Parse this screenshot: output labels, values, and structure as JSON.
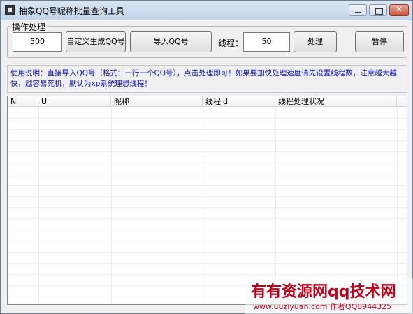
{
  "window": {
    "title": "抽象QQ号昵称批量查询工具",
    "controls": {
      "minimize": "minimize-icon",
      "maximize": "maximize-icon",
      "close": "✕"
    }
  },
  "ops_group": {
    "label": "操作处理",
    "count_value": "500",
    "gen_button": "自定义生成QQ号",
    "import_button": "导入QQ号",
    "threads_label": "线程：",
    "threads_value": "50",
    "process_button": "处理",
    "pause_button": "暂停"
  },
  "instructions": "使用说明：直接导入QQ号（格式：一行一个QQ号），点击处理即可！如果要加快处理速度请先设置线程数，注意越大越快，越容易死机，默认为xp系统理想线程！",
  "table": {
    "columns": [
      "N",
      "U",
      "昵称",
      "线程id",
      "线程处理状况"
    ],
    "rows": []
  },
  "watermark": {
    "main": "有有资源网qq技术网",
    "sub": "www.uuziyuan.com  作者QQ8944325"
  },
  "colors": {
    "instruction_text": "#1010c0",
    "watermark": "#c0001a"
  }
}
